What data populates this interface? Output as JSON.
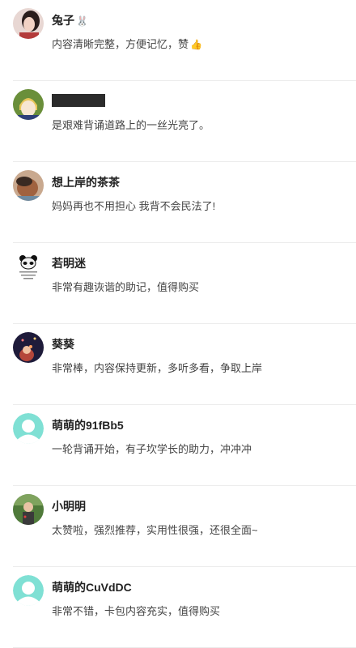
{
  "reviews": [
    {
      "name": "兔子",
      "name_emoji": "🐰",
      "comment": "内容清晰完整，方便记忆，赞",
      "comment_emoji": "👍",
      "avatar_icon": "photo-avatar-icon"
    },
    {
      "name": "",
      "name_redacted": true,
      "comment": "是艰难背诵道路上的一丝光亮了。",
      "avatar_icon": "anime-avatar-icon"
    },
    {
      "name": "想上岸的茶茶",
      "comment": "妈妈再也不用担心 我背不会民法了!",
      "avatar_icon": "photo-avatar-icon"
    },
    {
      "name": "若明迷",
      "comment": "非常有趣诙谐的助记，值得购买",
      "avatar_icon": "panda-avatar-icon"
    },
    {
      "name": "葵葵",
      "comment": "非常棒，内容保持更新，多听多看，争取上岸",
      "avatar_icon": "photo-avatar-icon"
    },
    {
      "name": "萌萌的91fBb5",
      "comment": "一轮背诵开始，有子坎学长的助力，冲冲冲",
      "avatar_icon": "default-user-avatar-icon"
    },
    {
      "name": "小明明",
      "comment": "太赞啦，强烈推荐，实用性很强，还很全面~",
      "avatar_icon": "photo-avatar-icon"
    },
    {
      "name": "萌萌的CuVdDC",
      "comment": "非常不错，卡包内容充实，值得购买",
      "avatar_icon": "default-user-avatar-icon"
    }
  ],
  "colors": {
    "default_avatar": "#7fe0d4",
    "divider": "#ececec"
  }
}
